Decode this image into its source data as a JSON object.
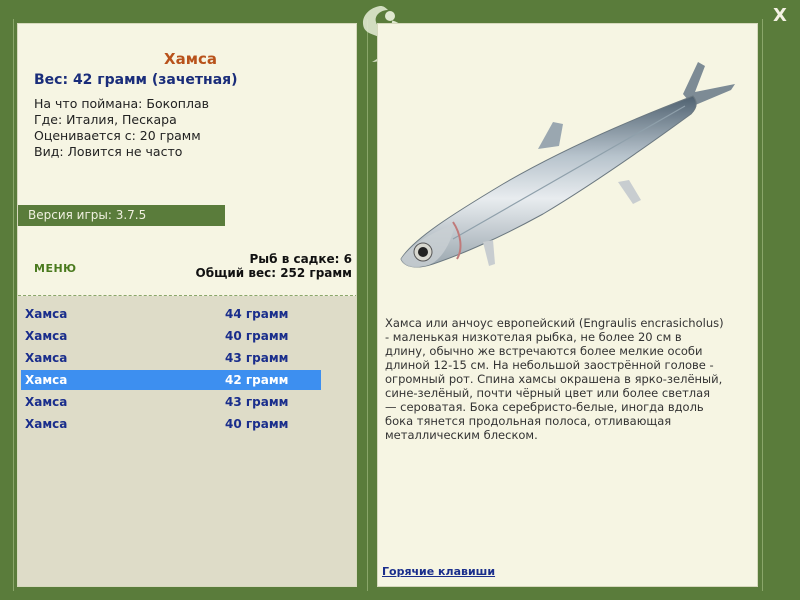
{
  "window": {
    "close_label": "X"
  },
  "fish": {
    "name": "Хамса",
    "weight": "Вес: 42 грамм (зачетная)",
    "caught_on": "На что поймана: Бокоплав",
    "location": "Где: Италия, Пескара",
    "rated_from": "Оценивается с: 20 грамм",
    "frequency": "Вид: Ловится не часто"
  },
  "version": "Версия игры: 3.7.5",
  "menu_label": "МЕНЮ",
  "stats": {
    "fish_in_cage": "Рыб в садке: 6",
    "total_weight": "Общий вес: 252 грамм"
  },
  "catch_list": [
    {
      "name": "Хамса",
      "weight": "44 грамм",
      "selected": false
    },
    {
      "name": "Хамса",
      "weight": "40 грамм",
      "selected": false
    },
    {
      "name": "Хамса",
      "weight": "43 грамм",
      "selected": false
    },
    {
      "name": "Хамса",
      "weight": "42 грамм",
      "selected": true
    },
    {
      "name": "Хамса",
      "weight": "43 грамм",
      "selected": false
    },
    {
      "name": "Хамса",
      "weight": "40 грамм",
      "selected": false
    }
  ],
  "description": "Хамса или анчоус европейский (Engraulis encrasicholus) - маленькая низкотелая рыбка, не более 20 см в длину, обычно же встречаются более мелкие особи длиной 12-15 см. На небольшой заострённой голове - огромный рот. Спина хамсы окрашена в ярко-зелёный, сине-зелёный, почти чёрный цвет или более светлая — сероватая. Бока серебристо-белые, иногда вдоль бока тянется продольная полоса, отливающая металлическим блеском.",
  "hotkeys_label": "Горячие клавиши",
  "colors": {
    "frame": "#5a7c3b",
    "panel": "#f6f5e3",
    "list_bg": "#dedcc8",
    "selected_row": "#3d8ff0",
    "title": "#b8521b",
    "link": "#1a2e8c"
  }
}
